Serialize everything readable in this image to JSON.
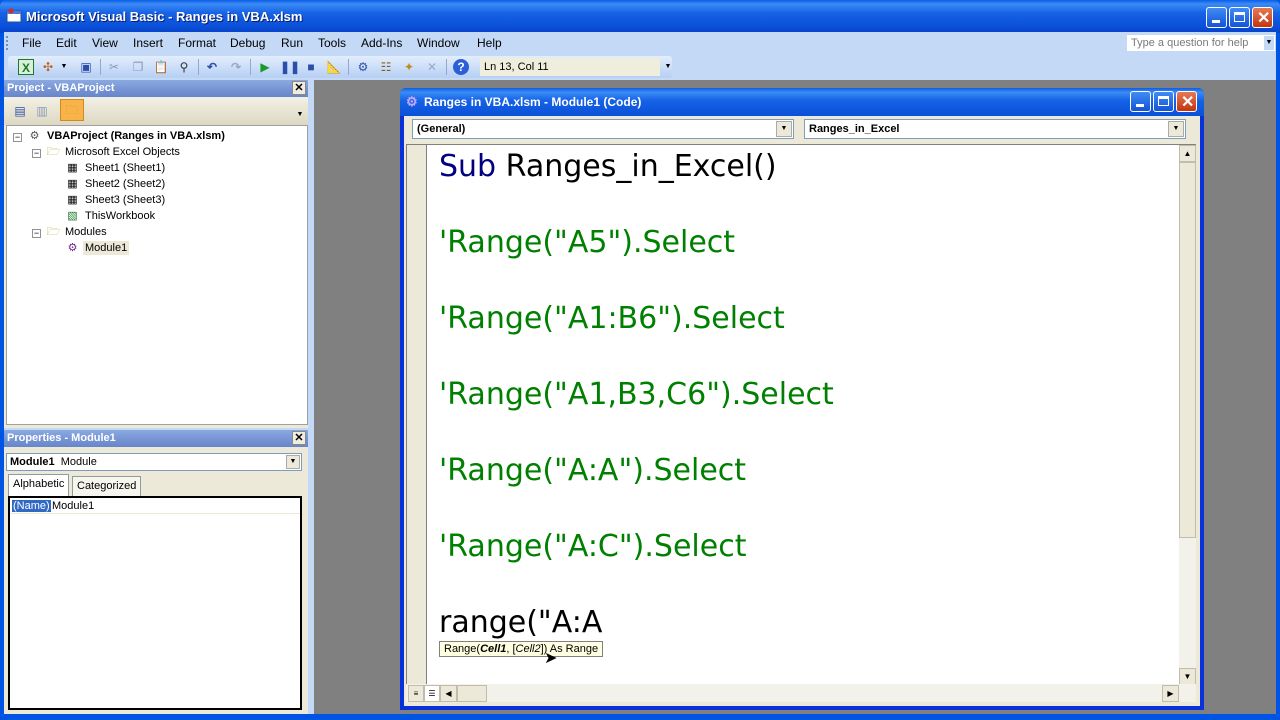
{
  "window": {
    "title": "Microsoft Visual Basic - Ranges in VBA.xlsm"
  },
  "menu": [
    "File",
    "Edit",
    "View",
    "Insert",
    "Format",
    "Debug",
    "Run",
    "Tools",
    "Add-Ins",
    "Window",
    "Help"
  ],
  "help_box": {
    "placeholder": "Type a question for help"
  },
  "toolbar": {
    "icons": [
      "view-excel-icon",
      "insert-object-icon",
      "save-icon",
      "cut-icon",
      "copy-icon",
      "paste-icon",
      "find-icon",
      "undo-icon",
      "redo-icon",
      "run-icon",
      "break-icon",
      "reset-icon",
      "design-mode-icon",
      "project-explorer-icon",
      "properties-window-icon",
      "object-browser-icon",
      "toolbox-icon",
      "help-icon"
    ],
    "position": "Ln 13, Col 11"
  },
  "project_panel": {
    "title": "Project - VBAProject",
    "tree": [
      {
        "label": "VBAProject (Ranges in VBA.xlsm)",
        "level": 0,
        "bold": true,
        "expanded": true
      },
      {
        "label": "Microsoft Excel Objects",
        "level": 1,
        "expanded": true
      },
      {
        "label": "Sheet1 (Sheet1)",
        "level": 2
      },
      {
        "label": "Sheet2 (Sheet2)",
        "level": 2
      },
      {
        "label": "Sheet3 (Sheet3)",
        "level": 2
      },
      {
        "label": "ThisWorkbook",
        "level": 2
      },
      {
        "label": "Modules",
        "level": 1,
        "expanded": true
      },
      {
        "label": "Module1",
        "level": 2,
        "selected": true
      }
    ]
  },
  "properties_panel": {
    "title": "Properties - Module1",
    "object_name": "Module1",
    "object_type": "Module",
    "tabs": [
      "Alphabetic",
      "Categorized"
    ],
    "active_tab": "Alphabetic",
    "rows": [
      {
        "name": "(Name)",
        "value": "Module1"
      }
    ]
  },
  "code_window": {
    "title": "Ranges in VBA.xlsm - Module1 (Code)",
    "object_combo": "(General)",
    "procedure_combo": "Ranges_in_Excel",
    "lines": [
      {
        "keyword": "Sub",
        "text": " Ranges_in_Excel()"
      },
      {
        "comment": "'Range(\"A5\").Select"
      },
      {
        "comment": "'Range(\"A1:B6\").Select"
      },
      {
        "comment": "'Range(\"A1,B3,C6\").Select"
      },
      {
        "comment": "'Range(\"A:A\").Select"
      },
      {
        "comment": "'Range(\"A:C\").Select"
      },
      {
        "text": "range(\"A:A"
      }
    ],
    "tooltip": {
      "prefix": "Range(",
      "arg1": "Cell1",
      "sep": ", [",
      "arg2": "Cell2",
      "suffix": "]) As Range"
    }
  }
}
